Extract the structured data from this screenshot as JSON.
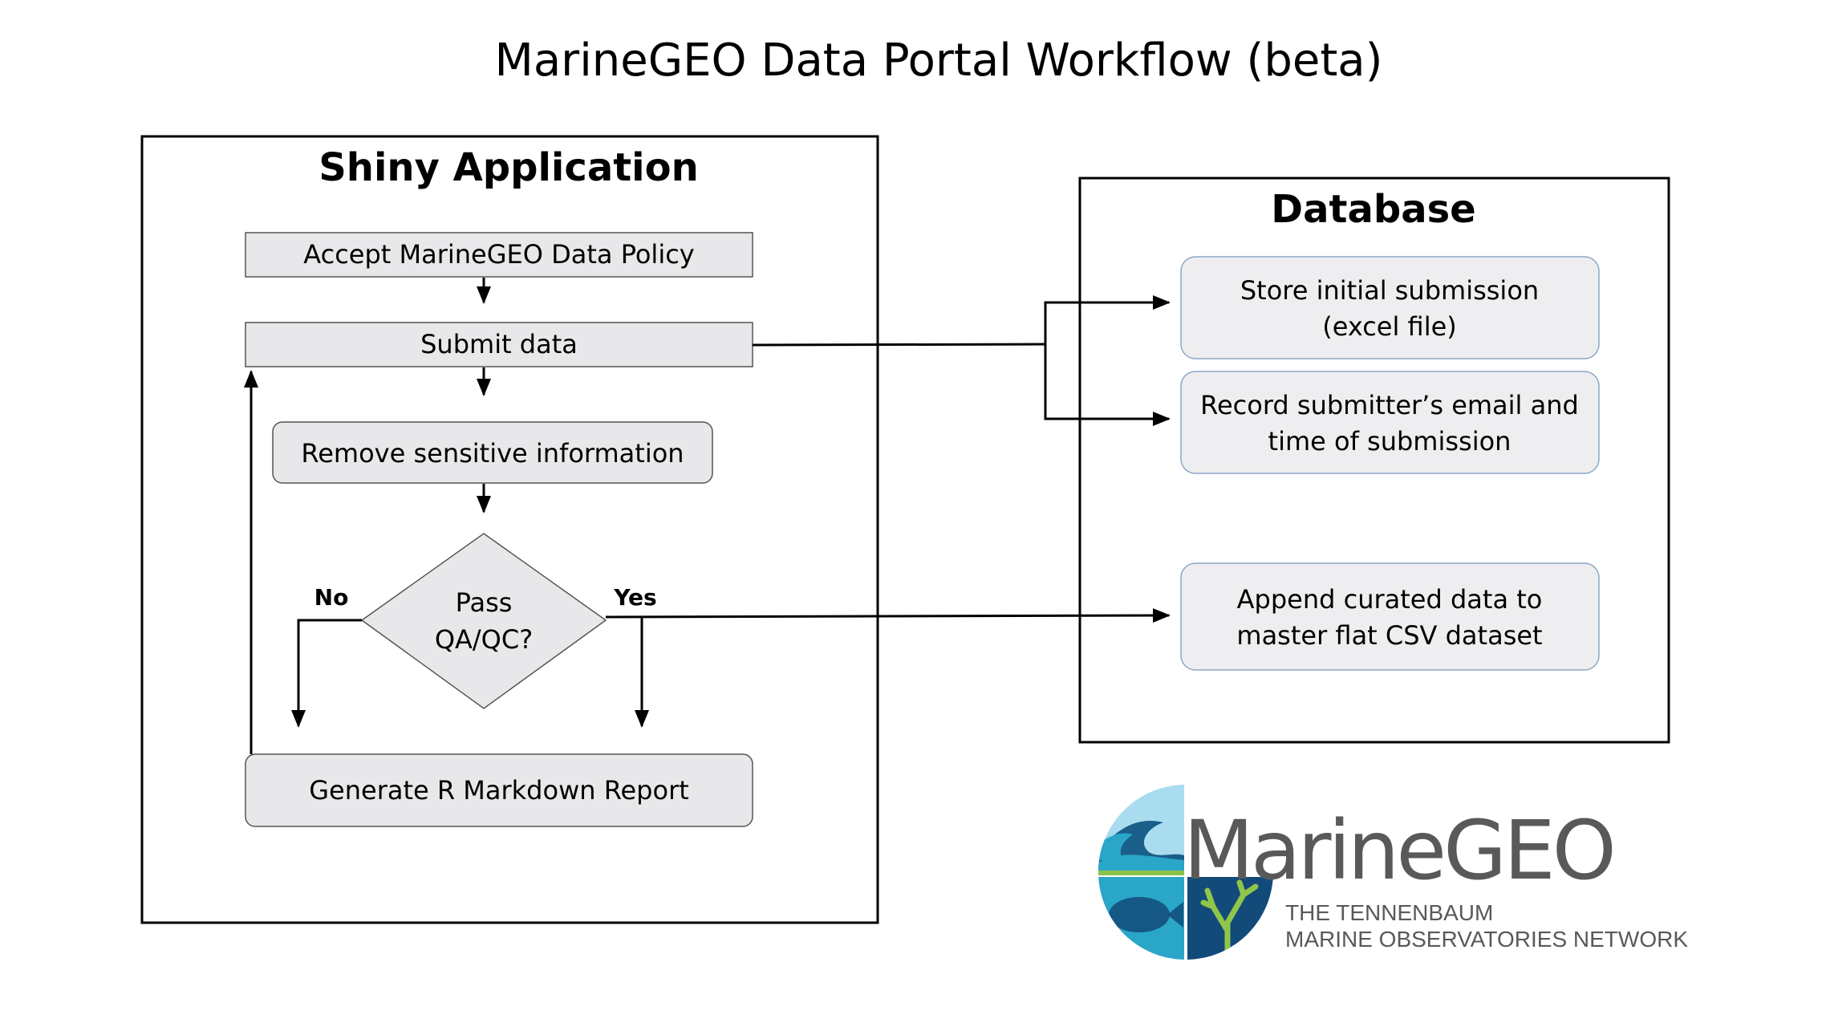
{
  "title": "MarineGEO Data Portal Workflow (beta)",
  "panels": {
    "shiny": {
      "title": "Shiny Application"
    },
    "database": {
      "title": "Database"
    }
  },
  "nodes": {
    "accept_policy": {
      "label": "Accept MarineGEO Data Policy"
    },
    "submit_data": {
      "label": "Submit data"
    },
    "remove_sensitive": {
      "label": "Remove sensitive information"
    },
    "pass_qaqc": {
      "line1": "Pass",
      "line2": "QA/QC?"
    },
    "generate_report": {
      "label": "Generate R Markdown Report"
    },
    "store_initial": {
      "line1": "Store initial submission",
      "line2": "(excel file)"
    },
    "record_email": {
      "line1": "Record submitter’s email and",
      "line2": "time of submission"
    },
    "append_curated": {
      "line1": "Append curated data to",
      "line2": "master flat CSV dataset"
    }
  },
  "edges": {
    "no_label": "No",
    "yes_label": "Yes"
  },
  "logo": {
    "wordmark": "MarineGEO",
    "subtitle_line1": "THE TENNENBAUM",
    "subtitle_line2": "MARINE OBSERVATORIES NETWORK",
    "colors": {
      "wave_dark": "#1a5e8a",
      "wave_light": "#2aa6c8",
      "sky": "#a9dcef",
      "green": "#8cc14a",
      "navy": "#124a79",
      "coral": "#8fc64a",
      "text": "#595959"
    }
  },
  "colors": {
    "box_fill": "#e8e7e9",
    "db_box_fill": "#eeeef0",
    "db_box_stroke": "#8ba7c4",
    "line": "#000000"
  }
}
